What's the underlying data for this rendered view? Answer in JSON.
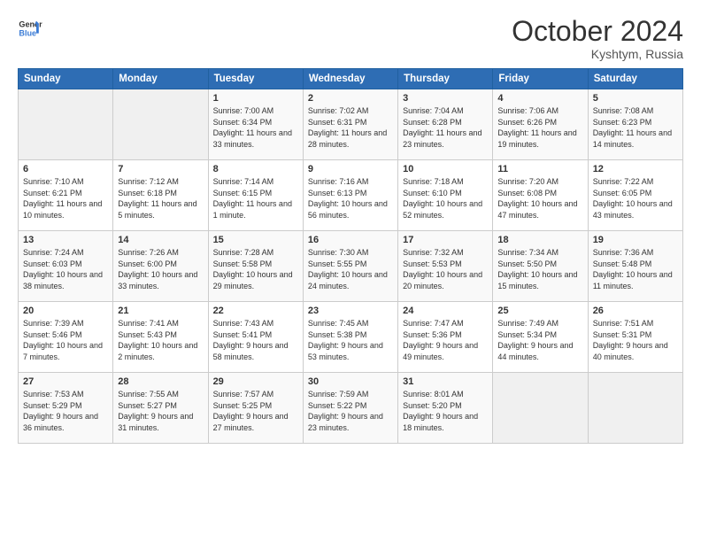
{
  "logo": {
    "line1": "General",
    "line2": "Blue"
  },
  "title": "October 2024",
  "location": "Kyshtym, Russia",
  "header": {
    "days": [
      "Sunday",
      "Monday",
      "Tuesday",
      "Wednesday",
      "Thursday",
      "Friday",
      "Saturday"
    ]
  },
  "weeks": [
    [
      {
        "day": "",
        "sunrise": "",
        "sunset": "",
        "daylight": ""
      },
      {
        "day": "",
        "sunrise": "",
        "sunset": "",
        "daylight": ""
      },
      {
        "day": "1",
        "sunrise": "Sunrise: 7:00 AM",
        "sunset": "Sunset: 6:34 PM",
        "daylight": "Daylight: 11 hours and 33 minutes."
      },
      {
        "day": "2",
        "sunrise": "Sunrise: 7:02 AM",
        "sunset": "Sunset: 6:31 PM",
        "daylight": "Daylight: 11 hours and 28 minutes."
      },
      {
        "day": "3",
        "sunrise": "Sunrise: 7:04 AM",
        "sunset": "Sunset: 6:28 PM",
        "daylight": "Daylight: 11 hours and 23 minutes."
      },
      {
        "day": "4",
        "sunrise": "Sunrise: 7:06 AM",
        "sunset": "Sunset: 6:26 PM",
        "daylight": "Daylight: 11 hours and 19 minutes."
      },
      {
        "day": "5",
        "sunrise": "Sunrise: 7:08 AM",
        "sunset": "Sunset: 6:23 PM",
        "daylight": "Daylight: 11 hours and 14 minutes."
      }
    ],
    [
      {
        "day": "6",
        "sunrise": "Sunrise: 7:10 AM",
        "sunset": "Sunset: 6:21 PM",
        "daylight": "Daylight: 11 hours and 10 minutes."
      },
      {
        "day": "7",
        "sunrise": "Sunrise: 7:12 AM",
        "sunset": "Sunset: 6:18 PM",
        "daylight": "Daylight: 11 hours and 5 minutes."
      },
      {
        "day": "8",
        "sunrise": "Sunrise: 7:14 AM",
        "sunset": "Sunset: 6:15 PM",
        "daylight": "Daylight: 11 hours and 1 minute."
      },
      {
        "day": "9",
        "sunrise": "Sunrise: 7:16 AM",
        "sunset": "Sunset: 6:13 PM",
        "daylight": "Daylight: 10 hours and 56 minutes."
      },
      {
        "day": "10",
        "sunrise": "Sunrise: 7:18 AM",
        "sunset": "Sunset: 6:10 PM",
        "daylight": "Daylight: 10 hours and 52 minutes."
      },
      {
        "day": "11",
        "sunrise": "Sunrise: 7:20 AM",
        "sunset": "Sunset: 6:08 PM",
        "daylight": "Daylight: 10 hours and 47 minutes."
      },
      {
        "day": "12",
        "sunrise": "Sunrise: 7:22 AM",
        "sunset": "Sunset: 6:05 PM",
        "daylight": "Daylight: 10 hours and 43 minutes."
      }
    ],
    [
      {
        "day": "13",
        "sunrise": "Sunrise: 7:24 AM",
        "sunset": "Sunset: 6:03 PM",
        "daylight": "Daylight: 10 hours and 38 minutes."
      },
      {
        "day": "14",
        "sunrise": "Sunrise: 7:26 AM",
        "sunset": "Sunset: 6:00 PM",
        "daylight": "Daylight: 10 hours and 33 minutes."
      },
      {
        "day": "15",
        "sunrise": "Sunrise: 7:28 AM",
        "sunset": "Sunset: 5:58 PM",
        "daylight": "Daylight: 10 hours and 29 minutes."
      },
      {
        "day": "16",
        "sunrise": "Sunrise: 7:30 AM",
        "sunset": "Sunset: 5:55 PM",
        "daylight": "Daylight: 10 hours and 24 minutes."
      },
      {
        "day": "17",
        "sunrise": "Sunrise: 7:32 AM",
        "sunset": "Sunset: 5:53 PM",
        "daylight": "Daylight: 10 hours and 20 minutes."
      },
      {
        "day": "18",
        "sunrise": "Sunrise: 7:34 AM",
        "sunset": "Sunset: 5:50 PM",
        "daylight": "Daylight: 10 hours and 15 minutes."
      },
      {
        "day": "19",
        "sunrise": "Sunrise: 7:36 AM",
        "sunset": "Sunset: 5:48 PM",
        "daylight": "Daylight: 10 hours and 11 minutes."
      }
    ],
    [
      {
        "day": "20",
        "sunrise": "Sunrise: 7:39 AM",
        "sunset": "Sunset: 5:46 PM",
        "daylight": "Daylight: 10 hours and 7 minutes."
      },
      {
        "day": "21",
        "sunrise": "Sunrise: 7:41 AM",
        "sunset": "Sunset: 5:43 PM",
        "daylight": "Daylight: 10 hours and 2 minutes."
      },
      {
        "day": "22",
        "sunrise": "Sunrise: 7:43 AM",
        "sunset": "Sunset: 5:41 PM",
        "daylight": "Daylight: 9 hours and 58 minutes."
      },
      {
        "day": "23",
        "sunrise": "Sunrise: 7:45 AM",
        "sunset": "Sunset: 5:38 PM",
        "daylight": "Daylight: 9 hours and 53 minutes."
      },
      {
        "day": "24",
        "sunrise": "Sunrise: 7:47 AM",
        "sunset": "Sunset: 5:36 PM",
        "daylight": "Daylight: 9 hours and 49 minutes."
      },
      {
        "day": "25",
        "sunrise": "Sunrise: 7:49 AM",
        "sunset": "Sunset: 5:34 PM",
        "daylight": "Daylight: 9 hours and 44 minutes."
      },
      {
        "day": "26",
        "sunrise": "Sunrise: 7:51 AM",
        "sunset": "Sunset: 5:31 PM",
        "daylight": "Daylight: 9 hours and 40 minutes."
      }
    ],
    [
      {
        "day": "27",
        "sunrise": "Sunrise: 7:53 AM",
        "sunset": "Sunset: 5:29 PM",
        "daylight": "Daylight: 9 hours and 36 minutes."
      },
      {
        "day": "28",
        "sunrise": "Sunrise: 7:55 AM",
        "sunset": "Sunset: 5:27 PM",
        "daylight": "Daylight: 9 hours and 31 minutes."
      },
      {
        "day": "29",
        "sunrise": "Sunrise: 7:57 AM",
        "sunset": "Sunset: 5:25 PM",
        "daylight": "Daylight: 9 hours and 27 minutes."
      },
      {
        "day": "30",
        "sunrise": "Sunrise: 7:59 AM",
        "sunset": "Sunset: 5:22 PM",
        "daylight": "Daylight: 9 hours and 23 minutes."
      },
      {
        "day": "31",
        "sunrise": "Sunrise: 8:01 AM",
        "sunset": "Sunset: 5:20 PM",
        "daylight": "Daylight: 9 hours and 18 minutes."
      },
      {
        "day": "",
        "sunrise": "",
        "sunset": "",
        "daylight": ""
      },
      {
        "day": "",
        "sunrise": "",
        "sunset": "",
        "daylight": ""
      }
    ]
  ]
}
